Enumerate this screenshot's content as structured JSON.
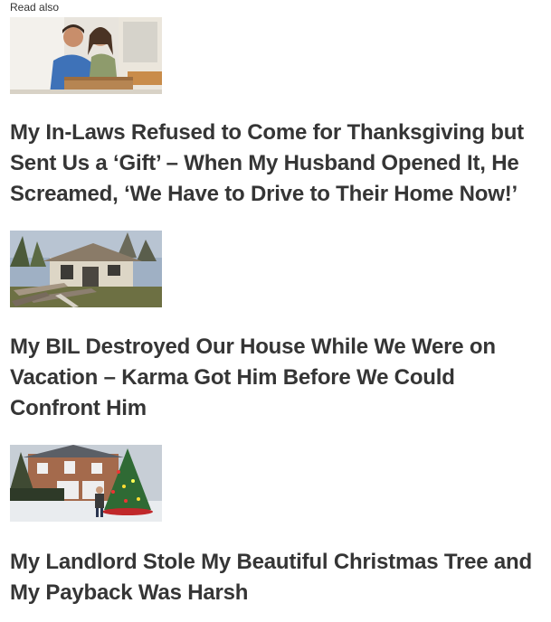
{
  "section_label": "Read also",
  "articles": [
    {
      "title": "My In-Laws Refused to Come for Thanksgiving but Sent Us a ‘Gift’ – When My Husband Opened It, He Screamed, ‘We Have to Drive to Their Home Now!’",
      "image_icon": "couple-opening-box-photo"
    },
    {
      "title": "My BIL Destroyed Our House While We Were on Vacation – Karma Got Him Before We Could Confront Him",
      "image_icon": "destroyed-house-photo"
    },
    {
      "title": "My Landlord Stole My Beautiful Christmas Tree and My Payback Was Harsh",
      "image_icon": "christmas-tree-house-photo"
    }
  ]
}
